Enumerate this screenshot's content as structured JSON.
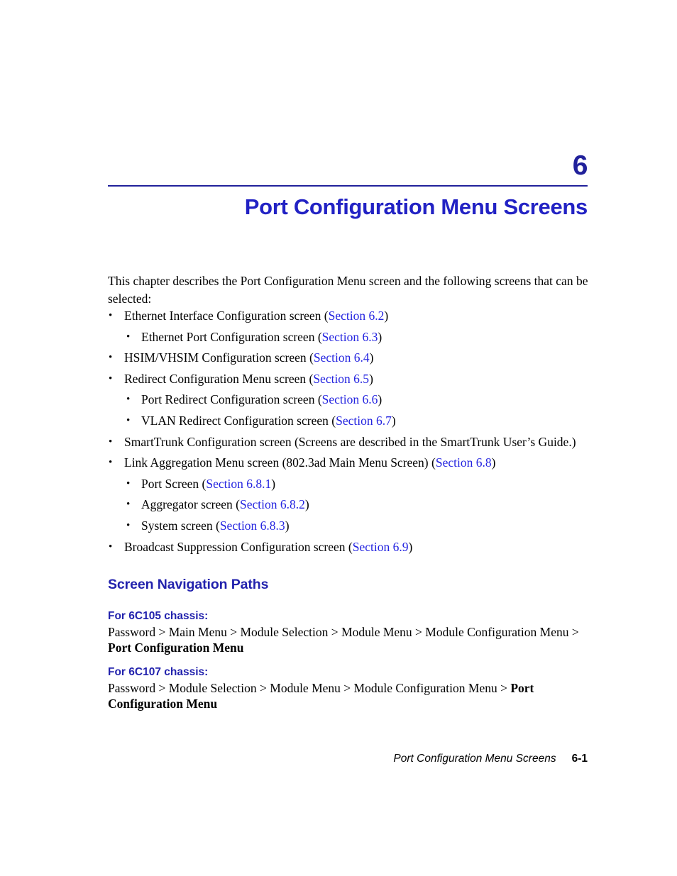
{
  "chapter": {
    "number": "6",
    "title": "Port Configuration Menu Screens"
  },
  "intro": {
    "paragraph": "This chapter describes the Port Configuration Menu screen and the following screens that can be selected:"
  },
  "bullets": [
    {
      "level": 1,
      "bullet": "•",
      "text": "Ethernet Interface Configuration screen (",
      "link": "Section 6.2",
      "tail": ")"
    },
    {
      "level": 2,
      "bullet": "•",
      "text": "Ethernet Port Configuration screen (",
      "link": "Section 6.3",
      "tail": ")"
    },
    {
      "level": 1,
      "bullet": "•",
      "text": "HSIM/VHSIM Configuration screen (",
      "link": "Section 6.4",
      "tail": ")"
    },
    {
      "level": 1,
      "bullet": "•",
      "text": "Redirect Configuration Menu screen (",
      "link": "Section 6.5",
      "tail": ")"
    },
    {
      "level": 2,
      "bullet": "•",
      "text": "Port Redirect Configuration screen (",
      "link": "Section 6.6",
      "tail": ")"
    },
    {
      "level": 2,
      "bullet": "•",
      "text": "VLAN Redirect Configuration screen (",
      "link": "Section 6.7",
      "tail": ")"
    },
    {
      "level": 1,
      "bullet": "•",
      "text": "SmartTrunk Configuration screen (Screens are described in the SmartTrunk User’s Guide.)",
      "link": "",
      "tail": ""
    },
    {
      "level": 1,
      "bullet": "•",
      "text": "Link Aggregation Menu screen (802.3ad Main Menu Screen) (",
      "link": "Section 6.8",
      "tail": ")"
    },
    {
      "level": 2,
      "bullet": "•",
      "text": "Port Screen (",
      "link": "Section 6.8.1",
      "tail": ")"
    },
    {
      "level": 2,
      "bullet": "•",
      "text": "Aggregator screen (",
      "link": "Section 6.8.2",
      "tail": ")"
    },
    {
      "level": 2,
      "bullet": "•",
      "text": "System screen (",
      "link": "Section 6.8.3",
      "tail": ")"
    },
    {
      "level": 1,
      "bullet": "•",
      "text": "Broadcast Suppression Configuration screen (",
      "link": "Section 6.9",
      "tail": ")"
    }
  ],
  "navigation": {
    "heading": "Screen Navigation Paths",
    "blocks": [
      {
        "label": "For 6C105 chassis:",
        "path_plain": "Password > Main Menu > Module Selection > Module Menu > Module Configuration Menu > ",
        "path_bold": "Port Configuration Menu"
      },
      {
        "label": "For 6C107 chassis:",
        "path_plain": "Password > Module Selection > Module Menu > Module Configuration Menu > ",
        "path_bold": "Port Configuration Menu"
      }
    ]
  },
  "footer": {
    "title": "Port Configuration Menu Screens",
    "page": "6-1"
  },
  "colors": {
    "chapter_number": "#21219b",
    "chapter_title": "#2222c4",
    "rule": "#21219b",
    "heading": "#2222ad",
    "cross_reference": "#2323e0",
    "body_text": "#000000",
    "background": "#ffffff"
  }
}
